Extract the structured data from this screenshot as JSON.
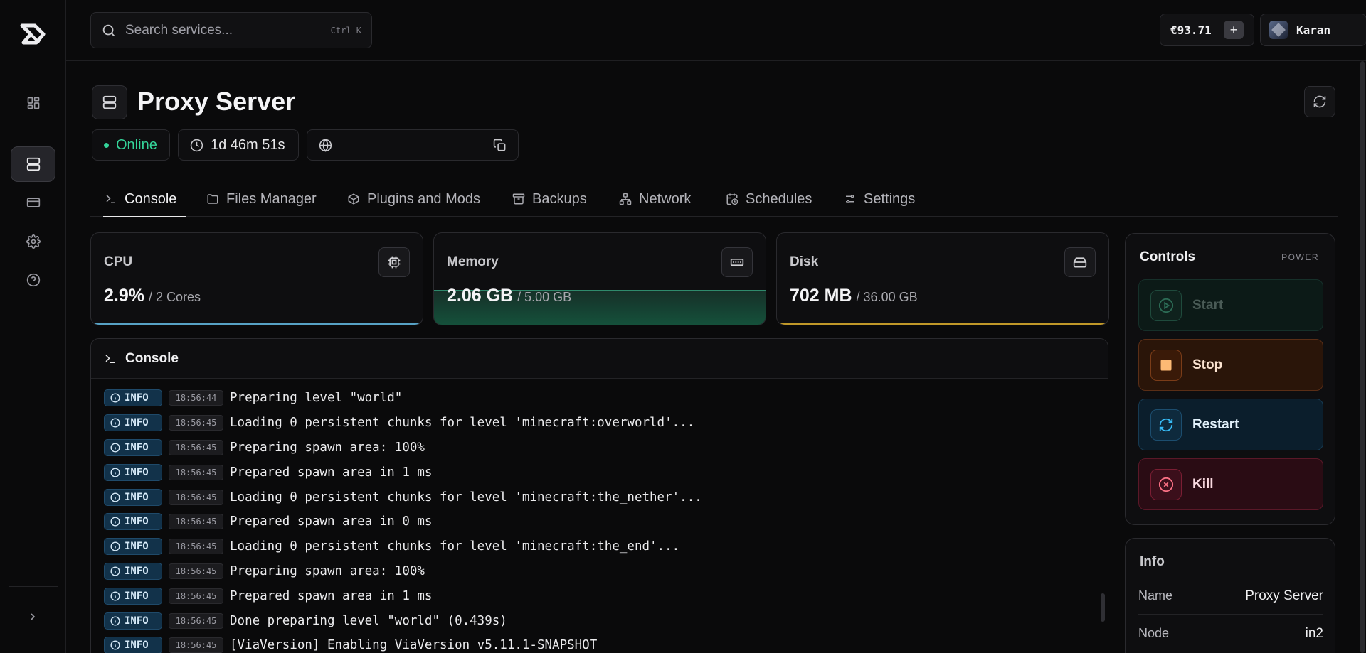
{
  "search": {
    "placeholder": "Search services...",
    "shortcut": "Ctrl K"
  },
  "account": {
    "balance": "€93.71",
    "add_label": "+",
    "username": "Karan"
  },
  "sidebar": {
    "items": [
      {
        "icon": "dashboard-icon"
      },
      {
        "icon": "server-icon",
        "active": true
      },
      {
        "icon": "billing-card-icon"
      },
      {
        "icon": "gear-icon"
      },
      {
        "icon": "help-icon"
      }
    ]
  },
  "server": {
    "title": "Proxy Server",
    "status": "Online",
    "uptime": "1d 46m 51s",
    "address": ""
  },
  "tabs": [
    {
      "label": "Console",
      "icon": "terminal-icon",
      "active": true
    },
    {
      "label": "Files Manager",
      "icon": "folder-icon"
    },
    {
      "label": "Plugins and Mods",
      "icon": "package-icon"
    },
    {
      "label": "Backups",
      "icon": "archive-icon"
    },
    {
      "label": "Network",
      "icon": "network-icon"
    },
    {
      "label": "Schedules",
      "icon": "calendar-clock-icon"
    },
    {
      "label": "Settings",
      "icon": "sliders-icon"
    }
  ],
  "resources": {
    "cpu": {
      "label": "CPU",
      "used": "2.9%",
      "total": "/ 2 Cores",
      "usage_fraction": 0.029,
      "color": "#5fb3d9"
    },
    "memory": {
      "label": "Memory",
      "used": "2.06 GB",
      "total": "/ 5.00 GB",
      "usage_fraction": 0.412,
      "color": "#2f8a6c"
    },
    "disk": {
      "label": "Disk",
      "used": "702 MB",
      "total": "/ 36.00 GB",
      "usage_fraction": 0.019,
      "color": "#d4a72c"
    }
  },
  "console": {
    "title": "Console",
    "lines": [
      {
        "level": "INFO",
        "time": "18:56:44",
        "text": "Preparing level \"world\""
      },
      {
        "level": "INFO",
        "time": "18:56:45",
        "text": "Loading 0 persistent chunks for level 'minecraft:overworld'..."
      },
      {
        "level": "INFO",
        "time": "18:56:45",
        "text": "Preparing spawn area: 100%"
      },
      {
        "level": "INFO",
        "time": "18:56:45",
        "text": "Prepared spawn area in 1 ms"
      },
      {
        "level": "INFO",
        "time": "18:56:45",
        "text": "Loading 0 persistent chunks for level 'minecraft:the_nether'..."
      },
      {
        "level": "INFO",
        "time": "18:56:45",
        "text": "Prepared spawn area in 0 ms"
      },
      {
        "level": "INFO",
        "time": "18:56:45",
        "text": "Loading 0 persistent chunks for level 'minecraft:the_end'..."
      },
      {
        "level": "INFO",
        "time": "18:56:45",
        "text": "Preparing spawn area: 100%"
      },
      {
        "level": "INFO",
        "time": "18:56:45",
        "text": "Prepared spawn area in 1 ms"
      },
      {
        "level": "INFO",
        "time": "18:56:45",
        "text": "Done preparing level \"world\" (0.439s)"
      },
      {
        "level": "INFO",
        "time": "18:56:45",
        "text": "[ViaVersion] Enabling ViaVersion v5.11.1-SNAPSHOT"
      }
    ]
  },
  "controls": {
    "title": "Controls",
    "subtitle": "POWER",
    "start": "Start",
    "stop": "Stop",
    "restart": "Restart",
    "kill": "Kill"
  },
  "info": {
    "title": "Info",
    "rows": [
      {
        "key": "Name",
        "value": "Proxy Server"
      },
      {
        "key": "Node",
        "value": "in2"
      }
    ]
  }
}
